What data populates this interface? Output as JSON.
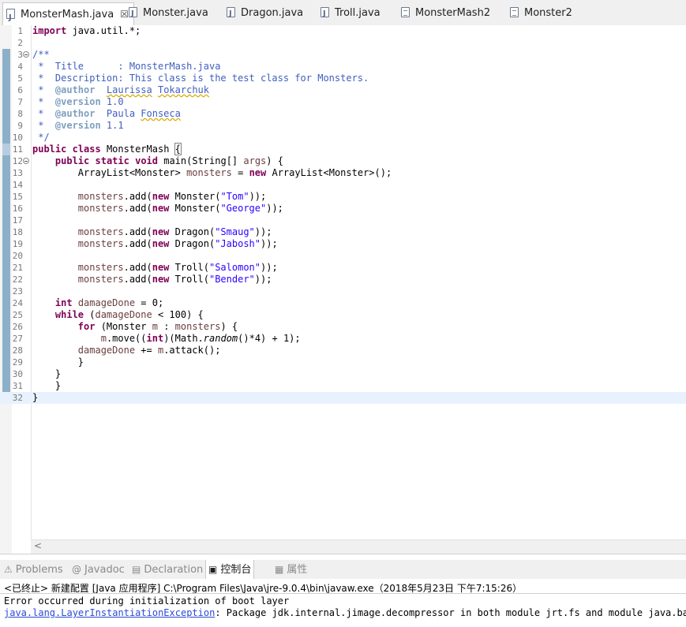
{
  "tabs": [
    {
      "label": "MonsterMash.java",
      "icon": "java-file-icon",
      "active": true,
      "close": "☒"
    },
    {
      "label": "Monster.java",
      "icon": "java-file-icon"
    },
    {
      "label": "Dragon.java",
      "icon": "java-file-icon"
    },
    {
      "label": "Troll.java",
      "icon": "java-file-icon"
    },
    {
      "label": "MonsterMash2",
      "icon": "text-file-icon"
    },
    {
      "label": "Monster2",
      "icon": "text-file-icon"
    }
  ],
  "editor": {
    "current_line": 32,
    "lines": [
      {
        "n": "1",
        "code": "import java.util.*;"
      },
      {
        "n": "2",
        "code": ""
      },
      {
        "n": "3",
        "code": "/**"
      },
      {
        "n": "4",
        "code": " *  Title      : MonsterMash.java"
      },
      {
        "n": "5",
        "code": " *  Description: This class is the test class for Monsters."
      },
      {
        "n": "6",
        "code": " *  @author  Laurissa Tokarchuk"
      },
      {
        "n": "7",
        "code": " *  @version 1.0"
      },
      {
        "n": "8",
        "code": " *  @author  Paula Fonseca"
      },
      {
        "n": "9",
        "code": " *  @version 1.1"
      },
      {
        "n": "10",
        "code": " */"
      },
      {
        "n": "11",
        "code": "public class MonsterMash {"
      },
      {
        "n": "12",
        "code": "    public static void main(String[] args) {"
      },
      {
        "n": "13",
        "code": "        ArrayList<Monster> monsters = new ArrayList<Monster>();"
      },
      {
        "n": "14",
        "code": ""
      },
      {
        "n": "15",
        "code": "        monsters.add(new Monster(\"Tom\"));"
      },
      {
        "n": "16",
        "code": "        monsters.add(new Monster(\"George\"));"
      },
      {
        "n": "17",
        "code": ""
      },
      {
        "n": "18",
        "code": "        monsters.add(new Dragon(\"Smaug\"));"
      },
      {
        "n": "19",
        "code": "        monsters.add(new Dragon(\"Jabosh\"));"
      },
      {
        "n": "20",
        "code": ""
      },
      {
        "n": "21",
        "code": "        monsters.add(new Troll(\"Salomon\"));"
      },
      {
        "n": "22",
        "code": "        monsters.add(new Troll(\"Bender\"));"
      },
      {
        "n": "23",
        "code": ""
      },
      {
        "n": "24",
        "code": "    int damageDone = 0;"
      },
      {
        "n": "25",
        "code": "    while (damageDone < 100) {"
      },
      {
        "n": "26",
        "code": "        for (Monster m : monsters) {"
      },
      {
        "n": "27",
        "code": "            m.move((int)(Math.random()*4) + 1);"
      },
      {
        "n": "28",
        "code": "        damageDone += m.attack();"
      },
      {
        "n": "29",
        "code": "        }"
      },
      {
        "n": "30",
        "code": "    }"
      },
      {
        "n": "31",
        "code": "    }"
      },
      {
        "n": "32",
        "code": "}"
      }
    ],
    "scroll_left_glyph": "<"
  },
  "panel": {
    "tabs": [
      {
        "label": "Problems",
        "icon": "problems-icon"
      },
      {
        "label": "Javadoc",
        "icon": "javadoc-icon"
      },
      {
        "label": "Declaration",
        "icon": "declaration-icon"
      },
      {
        "label": "控制台",
        "icon": "console-icon",
        "active": true
      },
      {
        "label": "属性",
        "icon": "properties-icon"
      }
    ]
  },
  "console": {
    "header": "<已终止> 新建配置 [Java 应用程序] C:\\Program Files\\Java\\jre-9.0.4\\bin\\javaw.exe（2018年5月23日 下午7:15:26）",
    "error_line1": "Error occurred during initialization of boot layer",
    "exception_link": "java.lang.LayerInstantiationException",
    "error_line2_rest": ": Package jdk.internal.jimage.decompressor in both module jrt.fs and module java.base"
  }
}
